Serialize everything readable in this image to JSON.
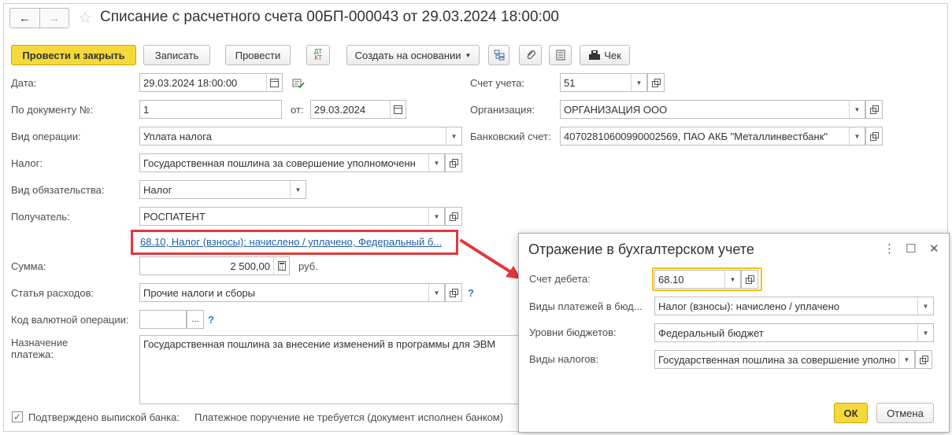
{
  "window": {
    "title": "Списание с расчетного счета 00БП-000043 от 29.03.2024 18:00:00",
    "nav_back": "←",
    "nav_forward": "→",
    "favorite_icon": "☆"
  },
  "toolbar": {
    "post_close": "Провести и закрыть",
    "save": "Записать",
    "post": "Провести",
    "dt_label": "ДТ",
    "kt_label": "КТ",
    "create_based": "Создать на основании",
    "receipt": "Чек",
    "accent_color": "#f5d93a"
  },
  "form": {
    "date_label": "Дата:",
    "date_value": "29.03.2024 18:00:00",
    "doc_no_label": "По документу №:",
    "doc_no_value": "1",
    "from_label": "от:",
    "from_value": "29.03.2024",
    "op_type_label": "Вид операции:",
    "op_type_value": "Уплата налога",
    "tax_label": "Налог:",
    "tax_value": "Государственная пошлина за совершение уполномоченн",
    "obligation_label": "Вид обязательства:",
    "obligation_value": "Налог",
    "recipient_label": "Получатель:",
    "recipient_value": "РОСПАТЕНТ",
    "accounting_link": "68.10, Налог (взносы): начислено / уплачено, Федеральный б...",
    "amount_label": "Сумма:",
    "amount_value": "2 500,00",
    "currency": "руб.",
    "expense_label": "Статья расходов:",
    "expense_value": "Прочие налоги и сборы",
    "currency_op_label": "Код валютной операции:",
    "currency_op_value": "",
    "ellipsis": "...",
    "help": "?",
    "purpose_label_1": "Назначение",
    "purpose_label_2": "платежа:",
    "purpose_value": "Государственная пошлина за внесение изменений в программы для ЭВМ",
    "confirmed_label": "Подтверждено выпиской банка:",
    "confirmed_checked": true,
    "payment_order_note": "Платежное поручение не требуется (документ исполнен банком)",
    "account_label": "Счет учета:",
    "account_value": "51",
    "org_label": "Организация:",
    "org_value": "ОРГАНИЗАЦИЯ ООО",
    "bank_label": "Банковский счет:",
    "bank_value": "40702810600990002569, ПАО АКБ \"Металлинвестбанк\""
  },
  "dialog": {
    "title": "Отражение в бухгалтерском учете",
    "more_icon": "⋮",
    "maximize_icon": "☐",
    "close_icon": "✕",
    "debit_label": "Счет дебета:",
    "debit_value": "68.10",
    "payment_kinds_label": "Виды платежей в бюд...",
    "payment_kinds_value": "Налог (взносы): начислено / уплачено",
    "budget_levels_label": "Уровни бюджетов:",
    "budget_levels_value": "Федеральный бюджет",
    "tax_kinds_label": "Виды налогов:",
    "tax_kinds_value": "Государственная пошлина за совершение уполно",
    "ok": "ОК",
    "cancel": "Отмена"
  }
}
